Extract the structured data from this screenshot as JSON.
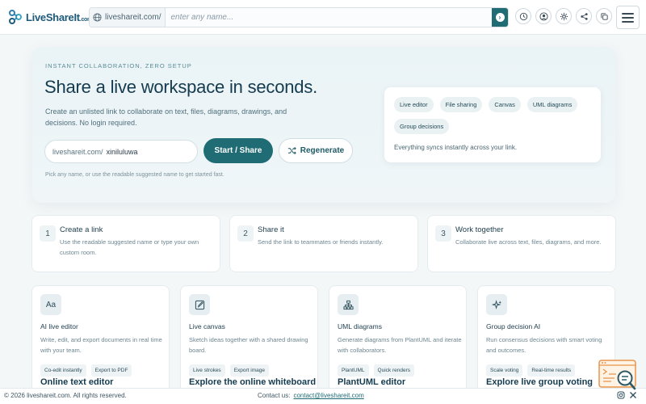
{
  "app": {
    "logo_text": "LiveShareIt",
    "logo_domain": ".com"
  },
  "urlbar": {
    "prefix": "liveshareit.com/",
    "placeholder": "enter any name...",
    "value": ""
  },
  "toolbar_icons": [
    "history-icon",
    "account-icon",
    "settings-icon",
    "share-icon",
    "copy-icon"
  ],
  "hero": {
    "eyebrow": "INSTANT COLLABORATION, ZERO SETUP",
    "title": "Share a live workspace in seconds.",
    "description": "Create an unlisted link to collaborate on text, files, diagrams, drawings, and decisions. No login required.",
    "name_prefix": "liveshareit.com/",
    "name_value": "xiniluluwa",
    "start_label": "Start / Share",
    "regenerate_label": "Regenerate",
    "hint": "Pick any name, or use the readable suggested name to get started fast.",
    "features": [
      "Live editor",
      "File sharing",
      "Canvas",
      "UML diagrams",
      "Group decisions"
    ],
    "features_note": "Everything syncs instantly across your link."
  },
  "steps": [
    {
      "num": "1",
      "title": "Create a link",
      "desc": "Use the readable suggested name or type your own custom room."
    },
    {
      "num": "2",
      "title": "Share it",
      "desc": "Send the link to teammates or friends instantly."
    },
    {
      "num": "3",
      "title": "Work together",
      "desc": "Collaborate live across text, files, diagrams, and more."
    }
  ],
  "tools": [
    {
      "icon": "Aa",
      "icon_name": "text-editor-icon",
      "title": "AI live editor",
      "desc": "Write, edit, and export documents in real time with your team.",
      "tags": [
        "Co-edit instantly",
        "Export to PDF"
      ],
      "link": "Online text editor"
    },
    {
      "icon": "",
      "icon_name": "edit-canvas-icon",
      "title": "Live canvas",
      "desc": "Sketch ideas together with a shared drawing board.",
      "tags": [
        "Live strokes",
        "Export image"
      ],
      "link": "Explore the online whiteboard"
    },
    {
      "icon": "",
      "icon_name": "diagram-icon",
      "title": "UML diagrams",
      "desc": "Generate diagrams from PlantUML and iterate with collaborators.",
      "tags": [
        "PlantUML",
        "Quick renders"
      ],
      "link": "PlantUML editor"
    },
    {
      "icon": "",
      "icon_name": "sparkle-icon",
      "title": "Group decision AI",
      "desc": "Run consensus decisions with smart voting and outcomes.",
      "tags": [
        "Scale voting",
        "Real-time results"
      ],
      "link": "Explore live group voting"
    }
  ],
  "footer": {
    "copyright": "© 2026 liveshareit.com. All rights reserved.",
    "contact_label": "Contact us:",
    "contact_email": "contact@liveshareit.com"
  },
  "colors": {
    "accent": "#1f6c75",
    "title": "#143b4f",
    "background": "#f4f7f8"
  }
}
